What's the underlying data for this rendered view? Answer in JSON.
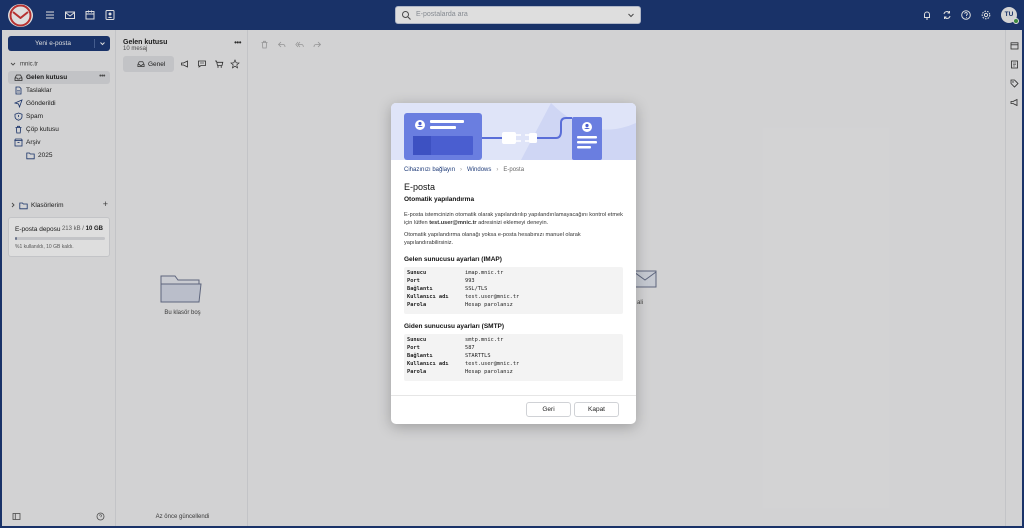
{
  "topbar": {
    "search_placeholder": "E-postalarda ara",
    "avatar_initials": "TU",
    "icons": [
      "menu-icon",
      "mail-icon",
      "calendar-icon",
      "contacts-icon",
      "bell-icon",
      "sync-icon",
      "help-icon",
      "gear-icon"
    ]
  },
  "sidebar": {
    "new_mail_label": "Yeni e-posta",
    "account": "mnic.tr",
    "folders": [
      {
        "label": "Gelen kutusu",
        "icon": "inbox-icon"
      },
      {
        "label": "Taslaklar",
        "icon": "draft-icon"
      },
      {
        "label": "Gönderildi",
        "icon": "send-icon"
      },
      {
        "label": "Spam",
        "icon": "spam-icon"
      },
      {
        "label": "Çöp kutusu",
        "icon": "trash-icon"
      },
      {
        "label": "Arşiv",
        "icon": "archive-icon"
      },
      {
        "label": "2025",
        "icon": "folder-icon"
      }
    ],
    "labels_section": "Klasörlerim",
    "storage": {
      "title": "E-posta deposu",
      "used": "213 kB",
      "separator": " / ",
      "total": "10 GB",
      "usage_fraction": 0.0,
      "detail": "%1 kullanıldı, 10 GB kaldı."
    }
  },
  "list": {
    "title": "Gelen kutusu",
    "count": "10 mesaj",
    "tab_general": "Genel",
    "empty_text": "Bu klasör boş",
    "footer": "Az önce güncellendi"
  },
  "reading": {
    "bg_text": "ali"
  },
  "modal": {
    "breadcrumb": [
      "Cihazınızı bağlayın",
      "Windows",
      "E-posta"
    ],
    "title": "E-posta",
    "subtitle": "Otomatik yapılandırma",
    "para1_a": "E-posta istemcinizin otomatik olarak yapılandırılıp yapılandırılamayacağını kontrol etmek için lütfen ",
    "para1_email": "test.user@mnic.tr",
    "para1_b": " adresinizi eklemeyi deneyin.",
    "para2": "Otomatik yapılandırma olanağı yoksa e-posta hesabınızı manuel olarak yapılandırabilirsiniz.",
    "imap": {
      "heading": "Gelen sunucusu ayarları (IMAP)",
      "rows": [
        {
          "k": "Sunucu",
          "v": "imap.mnic.tr"
        },
        {
          "k": "Port",
          "v": "993"
        },
        {
          "k": "Bağlantı",
          "v": "SSL/TLS"
        },
        {
          "k": "Kullanıcı adı",
          "v": "test.user@mnic.tr"
        },
        {
          "k": "Parola",
          "v": "Hesap parolanız"
        }
      ]
    },
    "smtp": {
      "heading": "Giden sunucusu ayarları (SMTP)",
      "rows": [
        {
          "k": "Sunucu",
          "v": "smtp.mnic.tr"
        },
        {
          "k": "Port",
          "v": "587"
        },
        {
          "k": "Bağlantı",
          "v": "STARTTLS"
        },
        {
          "k": "Kullanıcı adı",
          "v": "test.user@mnic.tr"
        },
        {
          "k": "Parola",
          "v": "Hesap parolanız"
        }
      ]
    },
    "back_label": "Geri",
    "close_label": "Kapat"
  }
}
